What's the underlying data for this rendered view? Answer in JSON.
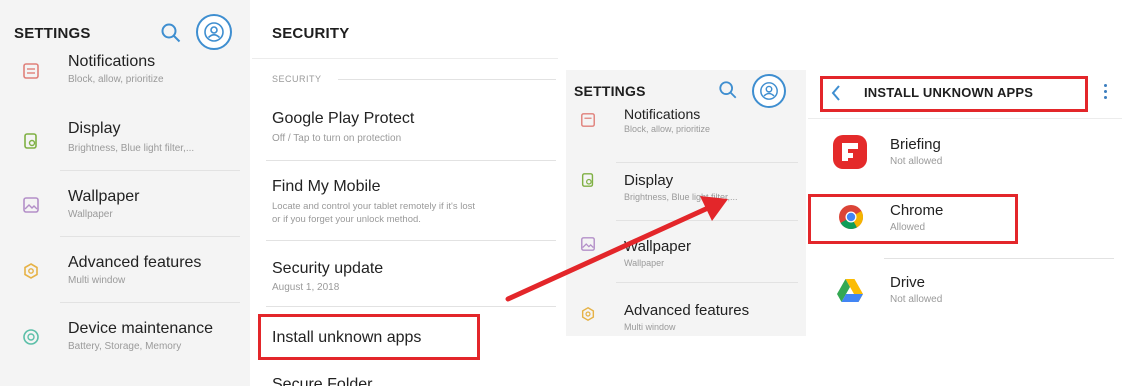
{
  "left": {
    "header": {
      "title": "SETTINGS"
    },
    "items": [
      {
        "title": "Notifications",
        "subtitle": "Block, allow, prioritize",
        "icon": "notifications-icon"
      },
      {
        "title": "Display",
        "subtitle": "Brightness, Blue light filter,...",
        "icon": "display-icon"
      },
      {
        "title": "Wallpaper",
        "subtitle": "Wallpaper",
        "icon": "wallpaper-icon"
      },
      {
        "title": "Advanced features",
        "subtitle": "Multi window",
        "icon": "advanced-features-icon"
      },
      {
        "title": "Device maintenance",
        "subtitle": "Battery, Storage, Memory",
        "icon": "device-maintenance-icon"
      }
    ]
  },
  "security": {
    "header": {
      "title": "SECURITY"
    },
    "section_label": "SECURITY",
    "items": [
      {
        "title": "Google Play Protect",
        "subtitle": "Off / Tap to turn on protection"
      },
      {
        "title": "Find My Mobile",
        "subtitle_line1": "Locate and control your tablet remotely if it's lost",
        "subtitle_line2": "or if you forget your unlock method."
      },
      {
        "title": "Security update",
        "subtitle": "August 1, 2018"
      },
      {
        "title": "Install unknown apps"
      },
      {
        "title": "Secure Folder"
      }
    ]
  },
  "right_settings": {
    "header": {
      "title": "SETTINGS"
    },
    "items": [
      {
        "title": "Notifications",
        "subtitle": "Block, allow, prioritize"
      },
      {
        "title": "Display",
        "subtitle": "Brightness, Blue light filter,..."
      },
      {
        "title": "Wallpaper",
        "subtitle": "Wallpaper"
      },
      {
        "title": "Advanced features",
        "subtitle": "Multi window"
      }
    ]
  },
  "install": {
    "header": {
      "title": "INSTALL UNKNOWN APPS"
    },
    "apps": [
      {
        "name": "Briefing",
        "status": "Not allowed",
        "icon": "briefing-icon"
      },
      {
        "name": "Chrome",
        "status": "Allowed",
        "icon": "chrome-icon"
      },
      {
        "name": "Drive",
        "status": "Not allowed",
        "icon": "drive-icon"
      }
    ]
  },
  "colors": {
    "highlight": "#e3262a",
    "accent": "#3e8ed0",
    "arrow": "#e3262a"
  }
}
